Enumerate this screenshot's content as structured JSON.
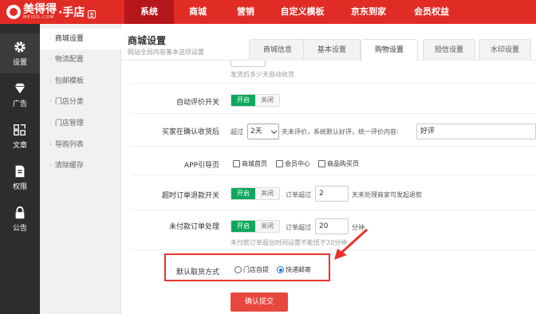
{
  "brand": {
    "name": "美得得",
    "sub": "MEIDD.COM",
    "suffix": "·手店"
  },
  "nav": [
    "系统",
    "商城",
    "营销",
    "自定义模板",
    "京东到家",
    "会员权益"
  ],
  "iconbar": [
    {
      "label": "设置",
      "icon": "gear-icon"
    },
    {
      "label": "广告",
      "icon": "diamond-icon"
    },
    {
      "label": "文章",
      "icon": "article-icon"
    },
    {
      "label": "权限",
      "icon": "document-icon"
    },
    {
      "label": "公告",
      "icon": "lock-icon"
    }
  ],
  "submenu": [
    "商城设置",
    "物流配置",
    "包邮模板",
    "门店分类",
    "门店管理",
    "导购列表",
    "清除缓存"
  ],
  "header": {
    "title": "商城设置",
    "subtitle": "网站全局内容基本选项设置",
    "tabs": [
      "商城信息",
      "基本设置",
      "购物设置",
      "短信设置",
      "水印设置"
    ]
  },
  "form": {
    "auto_receive_hint": "发货后多少天自动收货",
    "auto_review": {
      "label": "自动评价开关",
      "on": "开启",
      "off": "关闭"
    },
    "buyer_confirm": {
      "label": "买家在确认收货后",
      "prefix": "超过",
      "select_value": "2天",
      "mid": "天未评价，系统默认好评，统一评价内容:",
      "content_value": "好评"
    },
    "app_guide": {
      "label": "APP引导页",
      "options": [
        "商城首页",
        "会员中心",
        "商品购买页"
      ]
    },
    "timeout_refund": {
      "label": "超时订单退款开关",
      "on": "开启",
      "off": "关闭",
      "prefix": "订单超过",
      "value": "2",
      "suffix": "天未处理商家可发起退款"
    },
    "unpaid": {
      "label": "未付款订单处理",
      "on": "开启",
      "off": "关闭",
      "prefix": "订单超过",
      "value": "20",
      "suffix": "分钟",
      "hint": "未付款订单超出时间设置不能低于20分钟"
    },
    "delivery": {
      "label": "默认取货方式",
      "options": [
        "门店自提",
        "快递邮寄"
      ],
      "selected": "快递邮寄"
    },
    "submit_label": "确认提交"
  }
}
